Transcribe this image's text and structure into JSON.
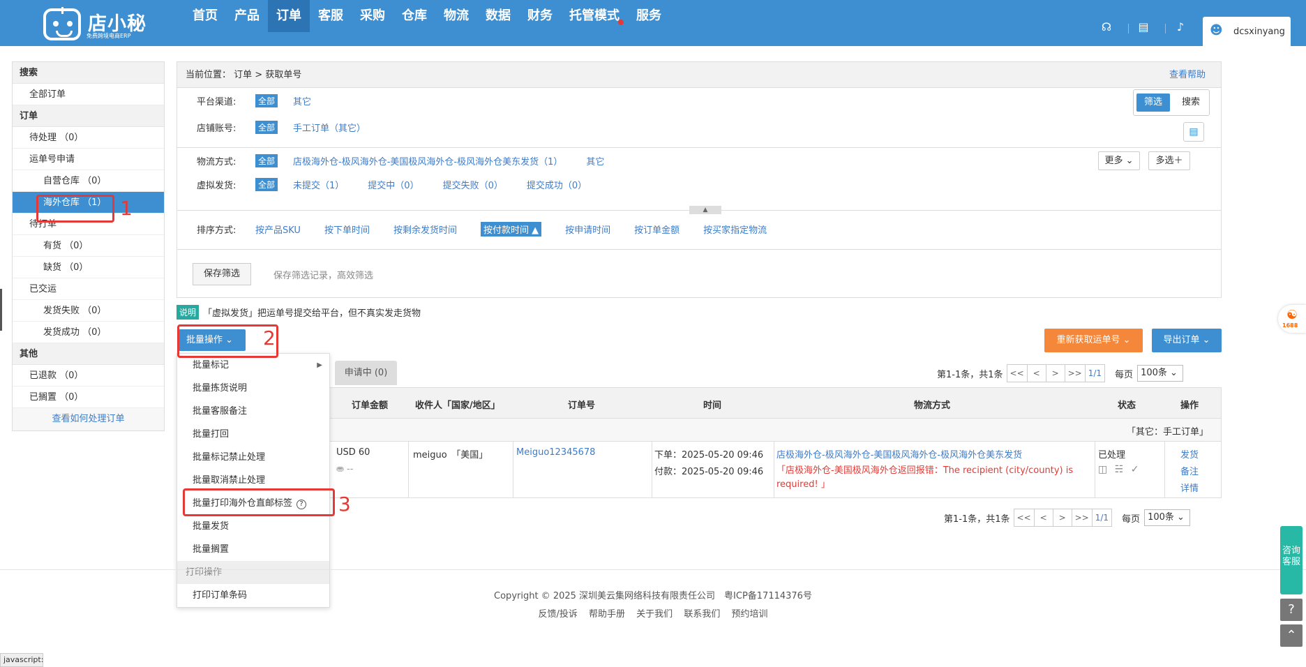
{
  "app": {
    "logo_name": "店小秘",
    "logo_sub": "免费跨境电商ERP",
    "user": "dcsxinyang"
  },
  "nav": [
    "首页",
    "产品",
    "订单",
    "客服",
    "采购",
    "仓库",
    "物流",
    "数据",
    "财务",
    "托管模式",
    "服务"
  ],
  "sidebar": {
    "sections": [
      {
        "head": "搜索",
        "items": [
          {
            "label": "全部订单"
          }
        ]
      },
      {
        "head": "订单",
        "items": [
          {
            "label": "待处理 （0）"
          },
          {
            "label": "运单号申请"
          },
          {
            "label": "自营仓库 （0）"
          },
          {
            "label": "海外仓库 （1）"
          },
          {
            "label": "待打单"
          },
          {
            "label": "有货 （0）"
          },
          {
            "label": "缺货 （0）"
          },
          {
            "label": "已交运"
          },
          {
            "label": "发货失败 （0）"
          },
          {
            "label": "发货成功 （0）"
          }
        ]
      },
      {
        "head": "其他",
        "items": [
          {
            "label": "已退款 （0）"
          },
          {
            "label": "已搁置 （0）"
          }
        ]
      }
    ],
    "help_link": "查看如何处理订单"
  },
  "annotations": [
    "1",
    "2",
    "3"
  ],
  "crumb": {
    "label": "当前位置：",
    "path": "订单 > 获取单号",
    "help": "查看帮助"
  },
  "filters": {
    "platform": {
      "label": "平台渠道:",
      "all": "全部",
      "options": [
        "其它"
      ]
    },
    "shop": {
      "label": "店铺账号:",
      "all": "全部",
      "options": [
        "手工订单（其它）"
      ]
    },
    "logistics": {
      "label": "物流方式:",
      "all": "全部",
      "options": [
        "店极海外仓-极风海外仓-美国极风海外仓-极风海外仓美东发货（1）",
        "其它"
      ]
    },
    "virtual": {
      "label": "虚拟发货:",
      "all": "全部",
      "options": [
        "未提交（1）",
        "提交中（0）",
        "提交失败（0）",
        "提交成功（0）"
      ]
    },
    "toggle_filter": "筛选",
    "toggle_search": "搜索",
    "more": "更多",
    "multi": "多选＋"
  },
  "sort": {
    "label": "排序方式:",
    "options": [
      "按产品SKU",
      "按下单时间",
      "按剩余发货时间",
      "按付款时间",
      "按申请时间",
      "按订单金额",
      "按买家指定物流"
    ],
    "active": "按付款时间"
  },
  "save": {
    "button": "保存筛选",
    "hint": "保存筛选记录，高效筛选"
  },
  "note": {
    "tag": "说明",
    "text": "「虚拟发货」把运单号提交给平台，但不真实发走货物"
  },
  "actions": {
    "batch": "批量操作",
    "reget": "重新获取运单号",
    "export": "导出订单"
  },
  "tab_pending": "申请中 (0)",
  "pager": {
    "summary": "第1-1条，共1条",
    "first": "<<",
    "prev": "<",
    "next": ">",
    "last": ">>",
    "page": "1/1",
    "per_label": "每页",
    "per": "100条"
  },
  "table": {
    "headers": [
      "订单金额",
      "收件人「国家/地区」",
      "订单号",
      "时间",
      "物流方式",
      "状态",
      "操作"
    ],
    "group": "「其它：手工订单」",
    "row": {
      "amount": "USD 60",
      "amount_sub": "--",
      "recipient": "meiguo　「美国」",
      "order_no": "Meiguo12345678",
      "time_order": "下单：2025-05-20 09:46",
      "time_pay": "付款：2025-05-20 09:46",
      "logistics": "店极海外仓-极风海外仓-美国极风海外仓-极风海外仓美东发货",
      "error": "「店极海外仓-美国极风海外仓返回报错：The recipient (city/county) is required! 」",
      "status": "已处理",
      "actions": [
        "发货",
        "备注",
        "详情"
      ]
    }
  },
  "dropdown": {
    "items": [
      "批量标记",
      "批量拣货说明",
      "批量客服备注",
      "批量打回",
      "批量标记禁止处理",
      "批量取消禁止处理",
      "批量打印海外仓直邮标签",
      "批量发货",
      "批量搁置"
    ],
    "print_head": "打印操作",
    "print_items": [
      "打印订单条码"
    ]
  },
  "footer": {
    "copyright": "Copyright © 2025 深圳美云集网络科技有限责任公司　粤ICP备17114376号",
    "links": [
      "反馈/投诉",
      "帮助手册",
      "关于我们",
      "联系我们",
      "预约培训"
    ]
  },
  "side": {
    "consult": "咨询客服",
    "badge": "1688"
  },
  "statusbar": "javascript:"
}
